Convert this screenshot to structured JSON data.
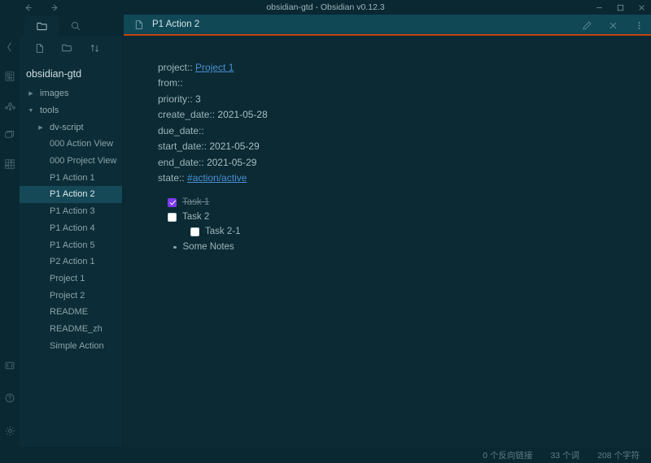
{
  "window": {
    "title": "obsidian-gtd - Obsidian v0.12.3",
    "nav": {
      "back": "back-arrow",
      "forward": "forward-arrow"
    },
    "controls": {
      "minimize": "−",
      "maximize": "□",
      "close": "✕"
    }
  },
  "ribbon": {
    "top": [
      {
        "name": "quick-switcher-icon"
      },
      {
        "name": "graph-view-icon"
      },
      {
        "name": "workspaces-icon"
      },
      {
        "name": "plugins-icon"
      }
    ],
    "bottom": [
      {
        "name": "open-vault-icon"
      },
      {
        "name": "help-icon"
      },
      {
        "name": "settings-gear-icon"
      }
    ]
  },
  "sidebar": {
    "tabs": [
      {
        "name": "file-explorer-tab",
        "icon": "folder-icon",
        "active": true
      },
      {
        "name": "search-tab",
        "icon": "search-icon",
        "active": false
      }
    ],
    "toolbar": [
      {
        "name": "new-note-button",
        "icon": "document-icon"
      },
      {
        "name": "new-folder-button",
        "icon": "folder-plus-icon"
      },
      {
        "name": "sort-button",
        "icon": "sort-arrows-icon"
      }
    ],
    "vault_name": "obsidian-gtd",
    "tree": [
      {
        "label": "images",
        "type": "folder",
        "expanded": false,
        "level": 1,
        "selected": false
      },
      {
        "label": "tools",
        "type": "folder",
        "expanded": true,
        "level": 1,
        "selected": false
      },
      {
        "label": "dv-script",
        "type": "folder",
        "expanded": false,
        "level": 2,
        "selected": false
      },
      {
        "label": "000 Action View",
        "type": "file",
        "level": 2,
        "selected": false
      },
      {
        "label": "000 Project View",
        "type": "file",
        "level": 2,
        "selected": false
      },
      {
        "label": "P1 Action 1",
        "type": "file",
        "level": 2,
        "selected": false
      },
      {
        "label": "P1 Action 2",
        "type": "file",
        "level": 2,
        "selected": true
      },
      {
        "label": "P1 Action 3",
        "type": "file",
        "level": 2,
        "selected": false
      },
      {
        "label": "P1 Action 4",
        "type": "file",
        "level": 2,
        "selected": false
      },
      {
        "label": "P1 Action 5",
        "type": "file",
        "level": 2,
        "selected": false
      },
      {
        "label": "P2 Action 1",
        "type": "file",
        "level": 2,
        "selected": false
      },
      {
        "label": "Project 1",
        "type": "file",
        "level": 2,
        "selected": false
      },
      {
        "label": "Project 2",
        "type": "file",
        "level": 2,
        "selected": false
      },
      {
        "label": "README",
        "type": "file",
        "level": 2,
        "selected": false
      },
      {
        "label": "README_zh",
        "type": "file",
        "level": 2,
        "selected": false
      },
      {
        "label": "Simple Action",
        "type": "file",
        "level": 2,
        "selected": false
      }
    ],
    "collapse_handle": "chevron-left-icon"
  },
  "main": {
    "tab": {
      "label": "P1 Action 2",
      "icon": "document-icon"
    },
    "actions": [
      {
        "name": "edit-mode-button",
        "icon": "pencil-icon"
      },
      {
        "name": "close-tab-button",
        "icon": "close-icon"
      },
      {
        "name": "more-options-button",
        "icon": "vertical-dots-icon"
      }
    ],
    "note": {
      "metadata": [
        {
          "key": "project::",
          "value": "Project 1",
          "is_link": true
        },
        {
          "key": "from::",
          "value": "",
          "is_link": false
        },
        {
          "key": "priority::",
          "value": "3",
          "is_link": false
        },
        {
          "key": "create_date::",
          "value": "2021-05-28",
          "is_link": false
        },
        {
          "key": "due_date::",
          "value": "",
          "is_link": false
        },
        {
          "key": "start_date::",
          "value": "2021-05-29",
          "is_link": false
        },
        {
          "key": "end_date::",
          "value": "2021-05-29",
          "is_link": false
        },
        {
          "key": "state::",
          "value": "#action/active",
          "is_link": true
        }
      ],
      "tasks": [
        {
          "label": "Task 1",
          "checked": true,
          "sub": false
        },
        {
          "label": "Task 2",
          "checked": false,
          "sub": false
        },
        {
          "label": "Task 2-1",
          "checked": false,
          "sub": true
        }
      ],
      "bullets": [
        {
          "label": "Some Notes"
        }
      ]
    }
  },
  "statusbar": {
    "backlinks": "0 个反向链接",
    "words": "33 个词",
    "chars": "208 个字符"
  },
  "colors": {
    "accent_tab_underline": "#c2410c",
    "link": "#4a8fd4",
    "checkbox_checked": "#7c3aed",
    "selection_bg": "#164957",
    "window_bg": "#0b2a33",
    "sidebar_bg": "#0c2d37",
    "chrome_bg": "#0a2832",
    "tabbar_bg": "#104856"
  }
}
